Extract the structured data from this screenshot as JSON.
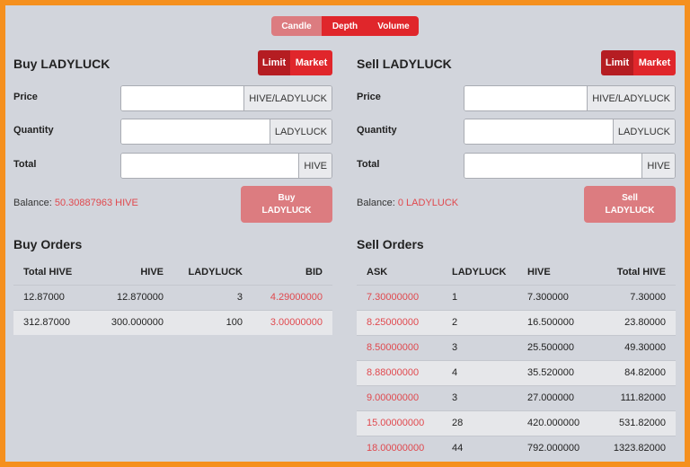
{
  "chart_tabs": [
    "Candle",
    "Depth",
    "Volume"
  ],
  "buy": {
    "title": "Buy LADYLUCK",
    "type_limit": "Limit",
    "type_market": "Market",
    "price_label": "Price",
    "price_unit": "HIVE/LADYLUCK",
    "quantity_label": "Quantity",
    "quantity_unit": "LADYLUCK",
    "total_label": "Total",
    "total_unit": "HIVE",
    "balance_label": "Balance:",
    "balance_value": "50.30887963 HIVE",
    "submit_line1": "Buy",
    "submit_line2": "LADYLUCK"
  },
  "sell": {
    "title": "Sell LADYLUCK",
    "type_limit": "Limit",
    "type_market": "Market",
    "price_label": "Price",
    "price_unit": "HIVE/LADYLUCK",
    "quantity_label": "Quantity",
    "quantity_unit": "LADYLUCK",
    "total_label": "Total",
    "total_unit": "HIVE",
    "balance_label": "Balance:",
    "balance_value": "0 LADYLUCK",
    "submit_line1": "Sell",
    "submit_line2": "LADYLUCK"
  },
  "buy_orders": {
    "title": "Buy Orders",
    "headers": [
      "Total HIVE",
      "HIVE",
      "LADYLUCK",
      "BID"
    ],
    "rows": [
      [
        "12.87000",
        "12.870000",
        "3",
        "4.29000000"
      ],
      [
        "312.87000",
        "300.000000",
        "100",
        "3.00000000"
      ]
    ]
  },
  "sell_orders": {
    "title": "Sell Orders",
    "headers": [
      "ASK",
      "LADYLUCK",
      "HIVE",
      "Total HIVE"
    ],
    "rows": [
      [
        "7.30000000",
        "1",
        "7.300000",
        "7.30000"
      ],
      [
        "8.25000000",
        "2",
        "16.500000",
        "23.80000"
      ],
      [
        "8.50000000",
        "3",
        "25.500000",
        "49.30000"
      ],
      [
        "8.88000000",
        "4",
        "35.520000",
        "84.82000"
      ],
      [
        "9.00000000",
        "3",
        "27.000000",
        "111.82000"
      ],
      [
        "15.00000000",
        "28",
        "420.000000",
        "531.82000"
      ],
      [
        "18.00000000",
        "44",
        "792.000000",
        "1323.82000"
      ]
    ]
  }
}
